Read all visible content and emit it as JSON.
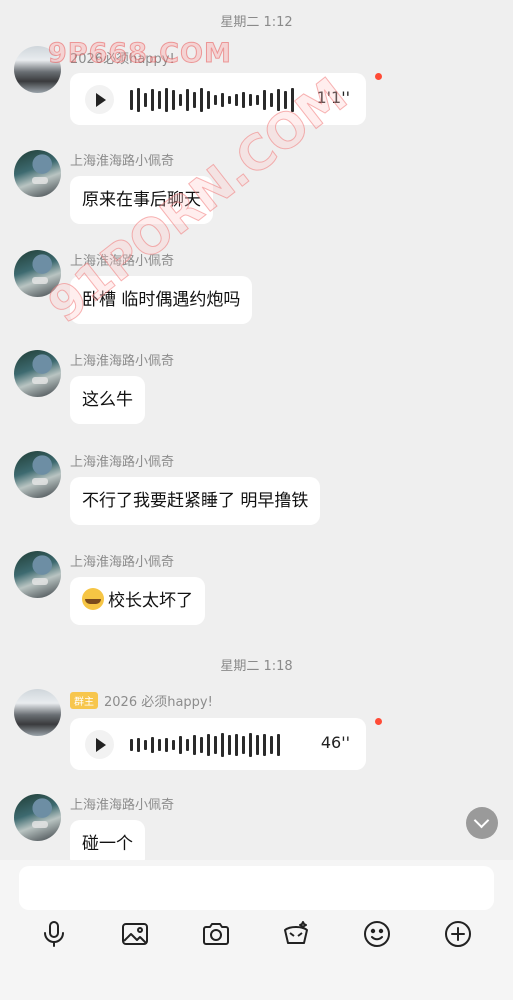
{
  "timestamps": [
    "星期二 1:12",
    "星期二 1:18"
  ],
  "watermarks": [
    "9P668.COM",
    "91PORN.COM"
  ],
  "messages": [
    {
      "type": "voice",
      "sender": "2026必须happy!",
      "duration": "1'1''",
      "unread": true
    },
    {
      "type": "text",
      "sender": "上海淮海路小佩奇",
      "text": "原来在事后聊天"
    },
    {
      "type": "text",
      "sender": "上海淮海路小佩奇",
      "text": "卧槽 临时偶遇约炮吗"
    },
    {
      "type": "text",
      "sender": "上海淮海路小佩奇",
      "text": "这么牛"
    },
    {
      "type": "text",
      "sender": "上海淮海路小佩奇",
      "text": "不行了我要赶紧睡了 明早撸铁"
    },
    {
      "type": "text",
      "sender": "上海淮海路小佩奇",
      "emoji": "crying-laughing-face",
      "text": "校长太坏了"
    },
    {
      "type": "voice",
      "sender": "2026 必须happy!",
      "tag": "群主",
      "duration": "46''",
      "unread": true
    },
    {
      "type": "text",
      "sender": "上海淮海路小佩奇",
      "text": "碰一个"
    }
  ],
  "input": {
    "value": "",
    "placeholder": ""
  },
  "toolbar": [
    "microphone-icon",
    "image-icon",
    "camera-icon",
    "hongbao-icon",
    "emoji-icon",
    "plus-icon"
  ],
  "colors": {
    "background": "#efefef",
    "bubble": "#ffffff",
    "unread_dot": "#ff4b36",
    "owner_tag": "#f7c64d"
  }
}
